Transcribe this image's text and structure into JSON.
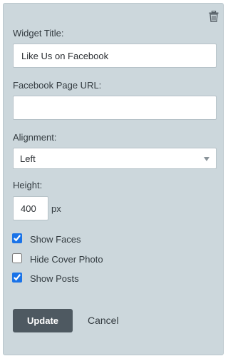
{
  "toolbar": {
    "delete_icon": "trash-icon"
  },
  "fields": {
    "widget_title_label": "Widget Title:",
    "widget_title_value": "Like Us on Facebook",
    "page_url_label": "Facebook Page URL:",
    "page_url_value": "",
    "alignment_label": "Alignment:",
    "alignment_value": "Left",
    "height_label": "Height:",
    "height_value": "400",
    "height_unit": "px"
  },
  "options": [
    {
      "label": "Show Faces",
      "checked": true
    },
    {
      "label": "Hide Cover Photo",
      "checked": false
    },
    {
      "label": "Show Posts",
      "checked": true
    }
  ],
  "actions": {
    "update_label": "Update",
    "cancel_label": "Cancel"
  },
  "colors": {
    "panel_background": "#ccd7dc",
    "update_button": "#4e5961",
    "checkbox_accent": "#1a73e8"
  }
}
